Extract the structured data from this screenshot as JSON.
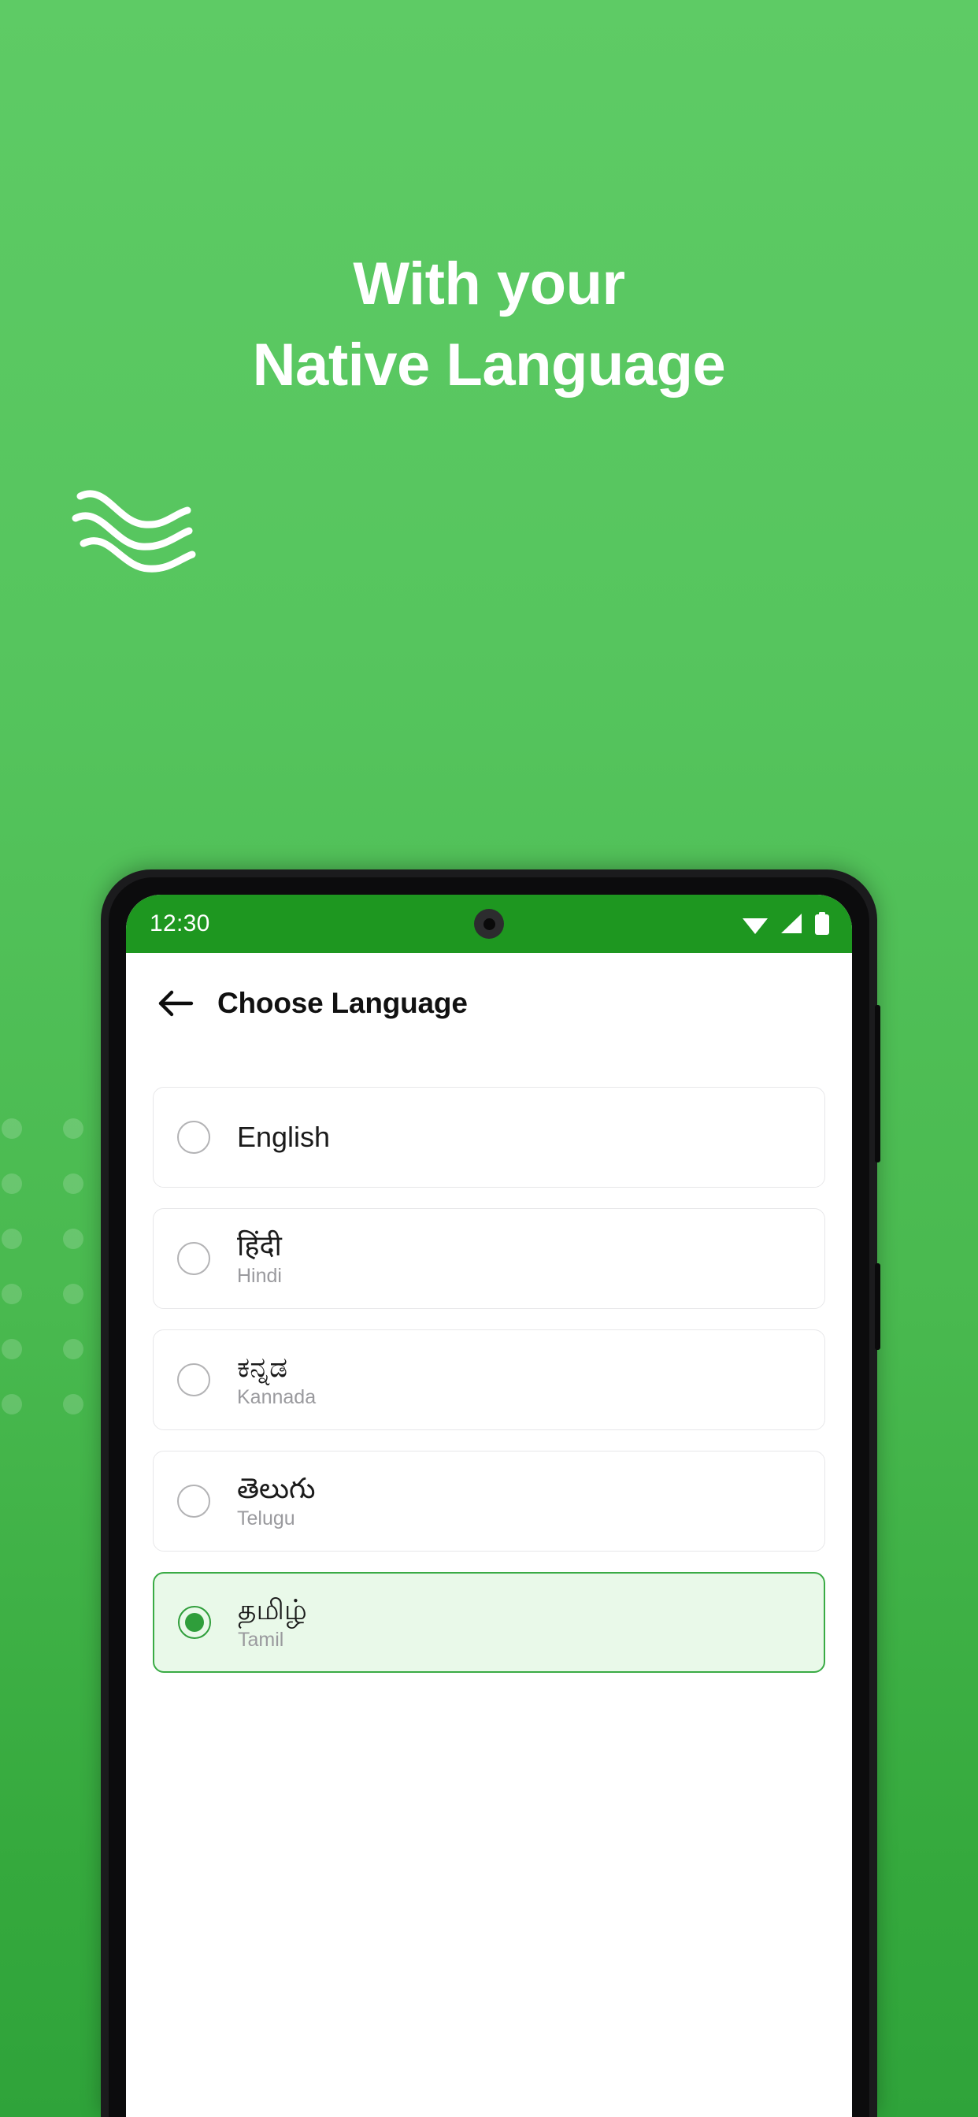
{
  "theme": {
    "bg_top": "#5ecb65",
    "bg_bottom": "#2fa33a",
    "status_bar_green": "#1e9720",
    "accent_green": "#2f9e3b",
    "selected_card_bg": "#e9f9e9",
    "selected_card_border": "#3aab45"
  },
  "promo": {
    "headline_line1": "With your",
    "headline_line2": "Native Language",
    "wave_icon": "waves-icon"
  },
  "phone": {
    "status_bar": {
      "time": "12:30",
      "icons": [
        "wifi-icon",
        "cellular-signal-icon",
        "battery-icon"
      ],
      "camera": "punch-hole-camera"
    },
    "app_bar": {
      "back_icon": "back-arrow-icon",
      "title": "Choose Language"
    },
    "languages": [
      {
        "native": "English",
        "subtitle": "",
        "selected": false
      },
      {
        "native": "हिंदी",
        "subtitle": "Hindi",
        "selected": false
      },
      {
        "native": "ಕನ್ನಡ",
        "subtitle": "Kannada",
        "selected": false
      },
      {
        "native": "తెలుగు",
        "subtitle": "Telugu",
        "selected": false
      },
      {
        "native": "தமிழ்",
        "subtitle": "Tamil",
        "selected": true
      }
    ]
  }
}
